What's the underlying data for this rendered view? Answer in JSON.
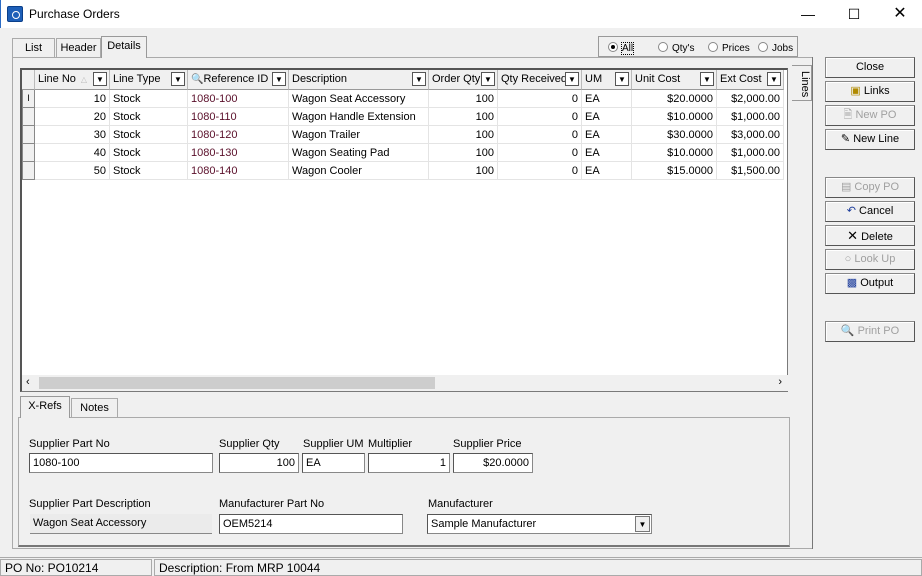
{
  "window": {
    "title": "Purchase Orders"
  },
  "tabs": [
    "List",
    "Header",
    "Details"
  ],
  "view_options": {
    "options": [
      "All",
      "Qty's",
      "Prices",
      "Jobs"
    ],
    "selected": "All"
  },
  "side_tab": "Lines",
  "grid": {
    "columns": [
      "Line No",
      "Line Type",
      "Reference ID",
      "Description",
      "Order Qty",
      "Qty Received",
      "UM",
      "Unit Cost",
      "Ext Cost"
    ],
    "rows": [
      [
        "10",
        "Stock",
        "1080-100",
        "Wagon Seat Accessory",
        "100",
        "0",
        "EA",
        "$20.0000",
        "$2,000.00"
      ],
      [
        "20",
        "Stock",
        "1080-110",
        "Wagon Handle Extension",
        "100",
        "0",
        "EA",
        "$10.0000",
        "$1,000.00"
      ],
      [
        "30",
        "Stock",
        "1080-120",
        "Wagon Trailer",
        "100",
        "0",
        "EA",
        "$30.0000",
        "$3,000.00"
      ],
      [
        "40",
        "Stock",
        "1080-130",
        "Wagon Seating Pad",
        "100",
        "0",
        "EA",
        "$10.0000",
        "$1,000.00"
      ],
      [
        "50",
        "Stock",
        "1080-140",
        "Wagon Cooler",
        "100",
        "0",
        "EA",
        "$15.0000",
        "$1,500.00"
      ]
    ]
  },
  "buttons": {
    "close": "Close",
    "links": "Links",
    "new_po": "New PO",
    "new_line": "New Line",
    "copy_po": "Copy PO",
    "cancel": "Cancel",
    "delete": "Delete",
    "look_up": "Look Up",
    "output": "Output",
    "print_po": "Print PO"
  },
  "bottom_tabs": [
    "X-Refs",
    "Notes"
  ],
  "xrefs": {
    "supplier_part_no_label": "Supplier Part No",
    "supplier_part_no": "1080-100",
    "supplier_qty_label": "Supplier Qty",
    "supplier_qty": "100",
    "supplier_um_label": "Supplier UM",
    "supplier_um": "EA",
    "multiplier_label": "Multiplier",
    "multiplier": "1",
    "supplier_price_label": "Supplier Price",
    "supplier_price": "$20.0000",
    "supplier_part_desc_label": "Supplier Part Description",
    "supplier_part_desc": "Wagon Seat Accessory",
    "mfr_part_no_label": "Manufacturer Part No",
    "mfr_part_no": "OEM5214",
    "manufacturer_label": "Manufacturer",
    "manufacturer": "Sample Manufacturer"
  },
  "status": {
    "po_no": "PO No: PO10214",
    "description": "Description: From MRP 10044"
  }
}
